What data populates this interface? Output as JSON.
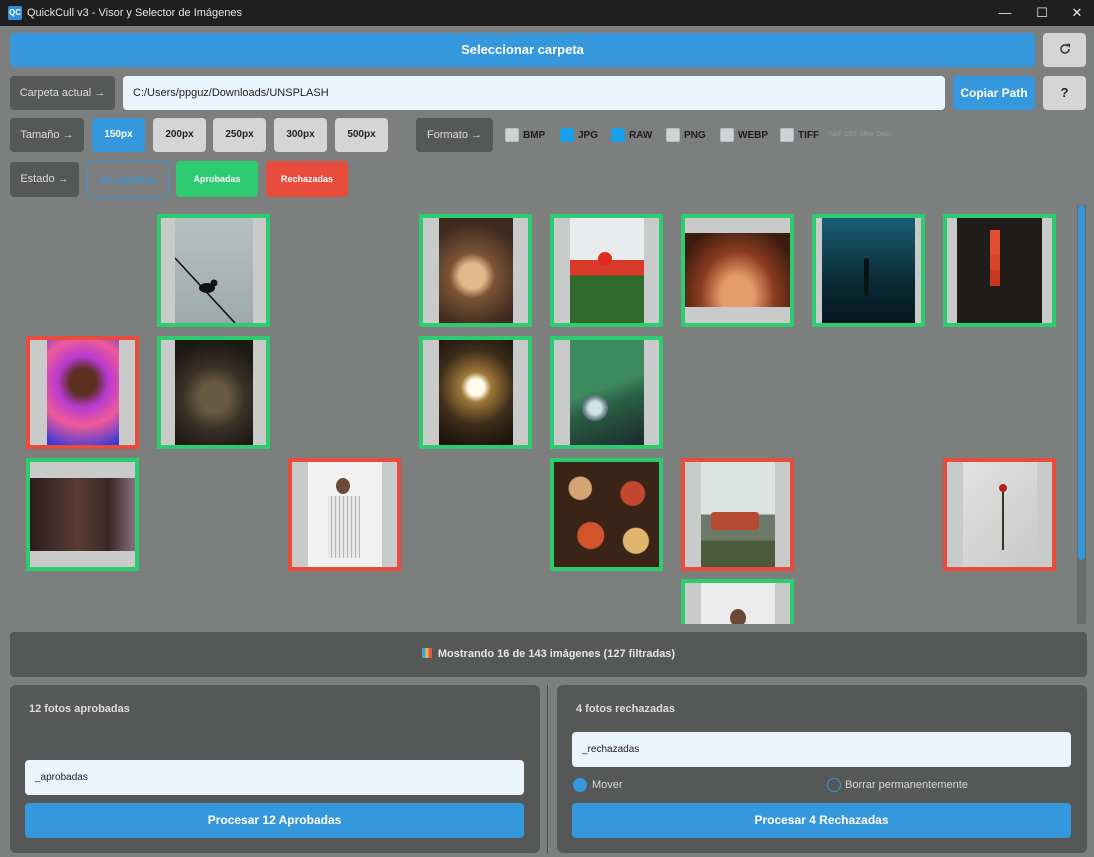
{
  "window": {
    "icon_text": "QC",
    "title": "QuickCull v3 - Visor y Selector de Imágenes",
    "minimize": "—",
    "maximize": "☐",
    "close": "✕"
  },
  "toolbar": {
    "select_folder_label": "Seleccionar carpeta",
    "refresh_icon": "refresh-icon"
  },
  "path_row": {
    "label": "Carpeta actual →",
    "path_value": "C:/Users/ppguz/Downloads/UNSPLASH",
    "copy_label": "Copiar Path",
    "help_label": "?"
  },
  "size_row": {
    "label": "Tamaño →",
    "options": [
      "150px",
      "200px",
      "250px",
      "300px",
      "500px"
    ],
    "selected": "150px"
  },
  "format_row": {
    "label": "Formato →",
    "formats": [
      {
        "label": "BMP",
        "checked": false
      },
      {
        "label": "JPG",
        "checked": true
      },
      {
        "label": "RAW",
        "checked": true
      },
      {
        "label": "PNG",
        "checked": false
      },
      {
        "label": "WEBP",
        "checked": false
      },
      {
        "label": "TIFF",
        "checked": false
      }
    ],
    "raw_note": "(NEF, CR2, ARW, DNG)"
  },
  "state_row": {
    "label": "Estado →",
    "unclassified": "Sin clasificar",
    "approved": "Aprobadas",
    "rejected": "Rechazadas"
  },
  "grid": {
    "thumbnails": [
      {
        "status": "approved",
        "subject": "bird on wire"
      },
      {
        "status": "approved",
        "subject": "person with glass ball"
      },
      {
        "status": "approved",
        "subject": "red poppies"
      },
      {
        "status": "approved",
        "subject": "desert cave"
      },
      {
        "status": "approved",
        "subject": "diver underwater"
      },
      {
        "status": "approved",
        "subject": "red flowers"
      },
      {
        "status": "rejected",
        "subject": "laughing person portrait"
      },
      {
        "status": "approved",
        "subject": "bird in nest"
      },
      {
        "status": "approved",
        "subject": "window in stone"
      },
      {
        "status": "approved",
        "subject": "green vintage car"
      },
      {
        "status": "approved",
        "subject": "face close-up"
      },
      {
        "status": "rejected",
        "subject": "woman in white"
      },
      {
        "status": "approved",
        "subject": "food table"
      },
      {
        "status": "rejected",
        "subject": "red truck"
      },
      {
        "status": "rejected",
        "subject": "rose on paper"
      },
      {
        "status": "approved",
        "subject": "man portrait"
      }
    ]
  },
  "status": {
    "text": "Mostrando 16 de 143 imágenes (127 filtradas)"
  },
  "approved_panel": {
    "title": "12 fotos aprobadas",
    "suffix_value": "_aprobadas",
    "process_label": "Procesar 12 Aprobadas"
  },
  "rejected_panel": {
    "title": "4 fotos rechazadas",
    "suffix_value": "_rechazadas",
    "move_label": "Mover",
    "delete_label": "Borrar permanentemente",
    "selected_action": "Mover",
    "process_label": "Procesar 4 Rechazadas"
  },
  "colors": {
    "accent": "#3597dc",
    "approved": "#2ecc71",
    "rejected": "#e74c3c",
    "background": "#7d7f7e"
  }
}
